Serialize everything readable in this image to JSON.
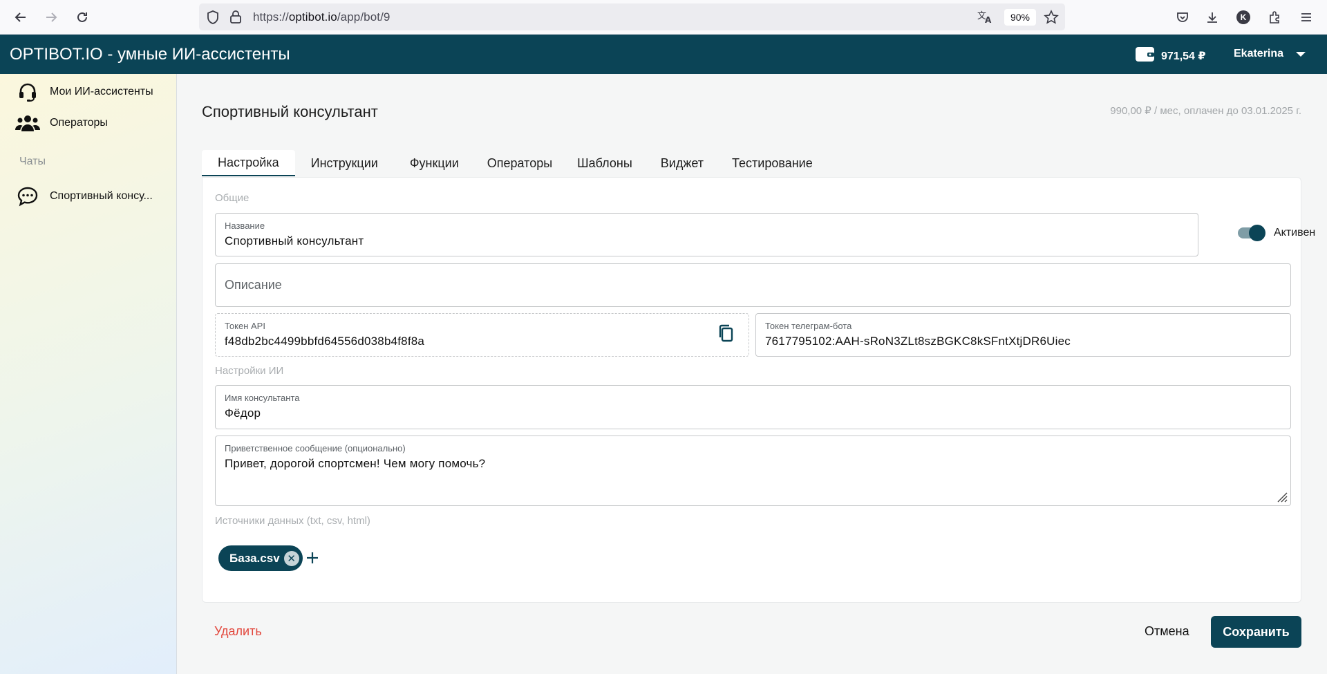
{
  "browser": {
    "url_prefix": "https://",
    "url_host": "optibot.io",
    "url_path": "/app/bot/9",
    "zoom": "90%",
    "profile_initial": "K"
  },
  "header": {
    "title": "OPTIBOT.IO - умные ИИ-ассистенты",
    "balance": "971,54 ₽",
    "user_name": "Ekaterina"
  },
  "sidebar": {
    "items": [
      {
        "label": "Мои ИИ-ассистенты",
        "icon": "headset-icon"
      },
      {
        "label": "Операторы",
        "icon": "users-icon"
      }
    ],
    "section_label": "Чаты",
    "chats": [
      {
        "label": "Спортивный консу...",
        "icon": "chat-bubble-icon"
      }
    ]
  },
  "page": {
    "title": "Спортивный консультант",
    "subscription": "990,00 ₽ / мес, оплачен до 03.01.2025 г."
  },
  "tabs": [
    {
      "label": "Настройка",
      "active": true
    },
    {
      "label": "Инструкции",
      "active": false
    },
    {
      "label": "Функции",
      "active": false
    },
    {
      "label": "Операторы",
      "active": false
    },
    {
      "label": "Шаблоны",
      "active": false
    },
    {
      "label": "Виджет",
      "active": false
    },
    {
      "label": "Тестирование",
      "active": false
    }
  ],
  "form": {
    "general_label": "Общие",
    "name": {
      "label": "Название",
      "value": "Спортивный консультант"
    },
    "active_toggle": {
      "label": "Активен",
      "on": true
    },
    "description": {
      "placeholder": "Описание"
    },
    "api_token": {
      "label": "Токен API",
      "value": "f48db2bc4499bbfd64556d038b4f8f8a"
    },
    "telegram_token": {
      "label": "Токен телеграм-бота",
      "value": "7617795102:AAH-sRoN3ZLt8szBGKC8kSFntXtjDR6Uiec"
    },
    "ai_settings_label": "Настройки ИИ",
    "consultant_name": {
      "label": "Имя консультанта",
      "value": "Фёдор"
    },
    "greeting": {
      "label": "Приветственное сообщение (опционально)",
      "value": "Привет, дорогой спортсмен! Чем могу помочь?"
    },
    "sources_label": "Источники данных (txt, csv, html)",
    "sources": [
      {
        "name": "База.csv"
      }
    ]
  },
  "actions": {
    "delete": "Удалить",
    "cancel": "Отмена",
    "save": "Сохранить"
  },
  "colors": {
    "primary": "#0b4456",
    "danger": "#e2463b"
  }
}
